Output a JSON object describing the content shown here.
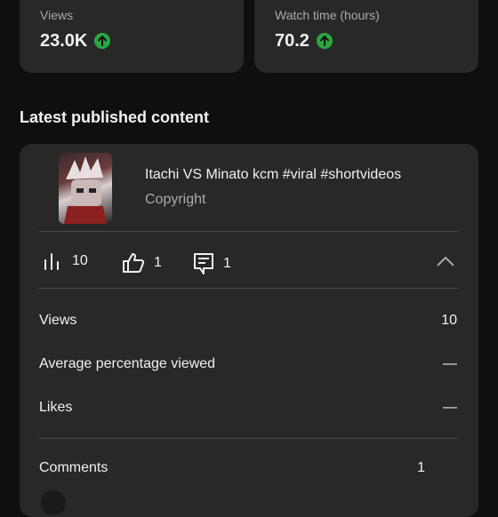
{
  "stats": [
    {
      "label": "Views",
      "value": "23.0K"
    },
    {
      "label": "Watch time (hours)",
      "value": "70.2"
    }
  ],
  "section_title": "Latest published content",
  "video": {
    "title": "Itachi VS Minato kcm #viral #shortvideos",
    "subtitle": "Copyright",
    "metrics": {
      "views": "10",
      "likes": "1",
      "comments": "1"
    }
  },
  "details": [
    {
      "label": "Views",
      "value": "10"
    },
    {
      "label": "Average percentage viewed",
      "value": "—"
    },
    {
      "label": "Likes",
      "value": "—"
    },
    {
      "label": "Comments",
      "value": "1"
    }
  ],
  "colors": {
    "background": "#0f0f0f",
    "card": "#282828",
    "up": "#2ba640"
  }
}
